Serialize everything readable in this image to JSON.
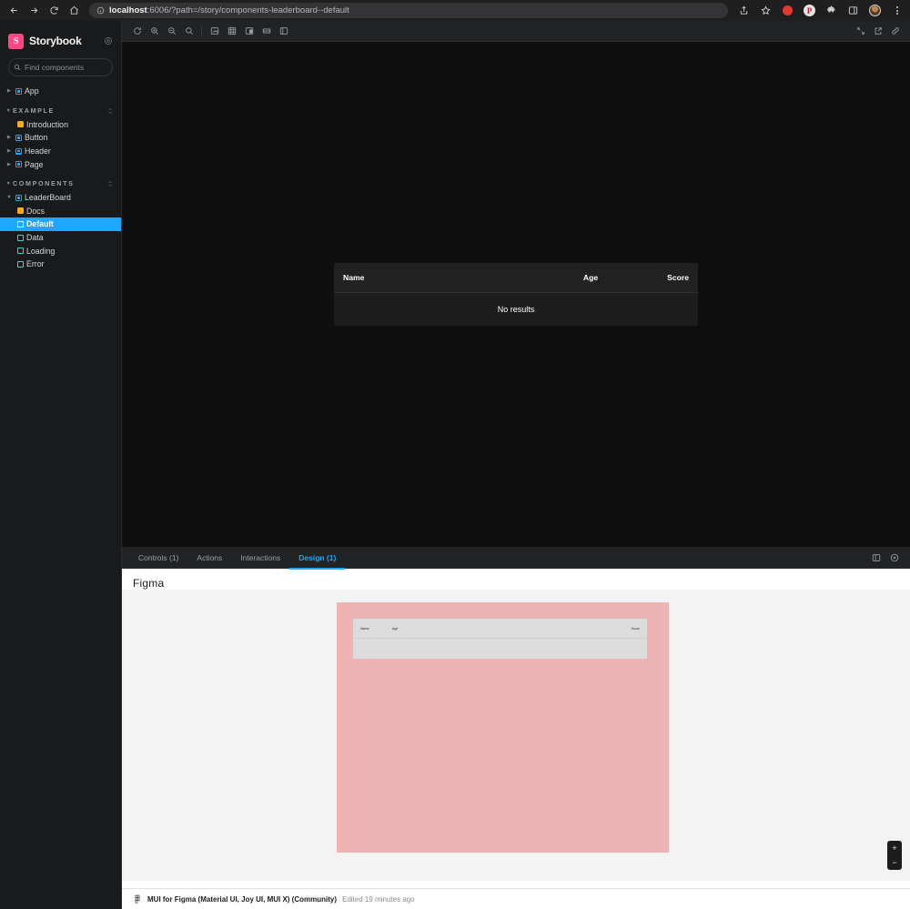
{
  "browser": {
    "back_icon": "arrow-left-icon",
    "forward_icon": "arrow-right-icon",
    "reload_icon": "reload-icon",
    "home_icon": "home-icon",
    "url_host": "localhost",
    "url_rest": ":6006/?path=/story/components-leaderboard--default",
    "info_icon": "info-circle-icon",
    "share_icon": "share-icon",
    "bookmark_icon": "star-icon",
    "record_icon": "record-dot-icon",
    "pinterest_label": "P",
    "extensions_icon": "puzzle-icon",
    "sidepanel_icon": "side-panel-icon",
    "avatar_icon": "user-avatar",
    "menu_icon": "kebab-menu-icon"
  },
  "sidebar": {
    "brand": "Storybook",
    "settings_icon": "gear-icon",
    "search": {
      "placeholder": "Find components",
      "value": "",
      "shortcut": "/",
      "icon": "search-icon"
    },
    "top_items": [
      {
        "label": "App",
        "icon": "component-icon",
        "expandable": true
      }
    ],
    "groups": [
      {
        "label": "EXAMPLE",
        "collapse_icon": "collapse-all-icon",
        "items": [
          {
            "label": "Introduction",
            "icon": "docs-icon",
            "type": "docs",
            "indent": 2
          },
          {
            "label": "Button",
            "icon": "component-icon",
            "type": "component",
            "indent": 1
          },
          {
            "label": "Header",
            "icon": "component-icon",
            "type": "component",
            "indent": 1
          },
          {
            "label": "Page",
            "icon": "component-icon",
            "type": "component",
            "indent": 1
          }
        ]
      },
      {
        "label": "COMPONENTS",
        "collapse_icon": "collapse-all-icon",
        "items": [
          {
            "label": "LeaderBoard",
            "icon": "component-icon",
            "type": "component",
            "indent": 1,
            "expanded": true
          },
          {
            "label": "Docs",
            "icon": "docs-icon",
            "type": "docs",
            "indent": 2
          },
          {
            "label": "Default",
            "icon": "story-icon",
            "type": "story",
            "indent": 2,
            "selected": true
          },
          {
            "label": "Data",
            "icon": "story-icon",
            "type": "story",
            "indent": 2
          },
          {
            "label": "Loading",
            "icon": "story-icon",
            "type": "story",
            "indent": 2
          },
          {
            "label": "Error",
            "icon": "story-icon",
            "type": "story",
            "indent": 2
          }
        ]
      }
    ]
  },
  "canvas_toolbar": {
    "left_buttons": [
      {
        "name": "remount-button",
        "icon": "reload-icon"
      },
      {
        "name": "zoom-in-button",
        "icon": "zoom-in-icon"
      },
      {
        "name": "zoom-out-button",
        "icon": "zoom-out-icon"
      },
      {
        "name": "zoom-reset-button",
        "icon": "zoom-reset-icon"
      },
      {
        "name": "backgrounds-button",
        "icon": "photo-icon"
      },
      {
        "name": "grid-button",
        "icon": "grid-icon"
      },
      {
        "name": "viewport-button",
        "icon": "viewport-icon"
      },
      {
        "name": "measure-button",
        "icon": "measure-icon"
      },
      {
        "name": "outline-button",
        "icon": "outline-icon"
      }
    ],
    "right_buttons": [
      {
        "name": "fullscreen-button",
        "icon": "expand-icon"
      },
      {
        "name": "open-new-tab-button",
        "icon": "external-link-icon"
      },
      {
        "name": "copy-link-button",
        "icon": "link-icon"
      }
    ]
  },
  "preview": {
    "table": {
      "columns": [
        "Name",
        "Age",
        "Score"
      ],
      "empty_message": "No results",
      "rows": []
    }
  },
  "addon_panel": {
    "tabs": [
      {
        "label": "Controls (1)",
        "active": false
      },
      {
        "label": "Actions",
        "active": false
      },
      {
        "label": "Interactions",
        "active": false
      },
      {
        "label": "Design (1)",
        "active": true
      }
    ],
    "layout_icon": "panel-position-icon",
    "close_icon": "close-circle-icon",
    "design": {
      "title": "Figma",
      "mock_columns": [
        "Name",
        "Age",
        "Score"
      ],
      "zoom_in": "+",
      "zoom_out": "−",
      "footer": {
        "icon": "figma-icon",
        "file_name": "MUI for Figma (Material UI, Joy UI, MUI X) (Community)",
        "edited": "Edited 19 minutes ago"
      }
    }
  },
  "colors": {
    "accent": "#1ea7fd",
    "brand": "#ff4785",
    "docs_icon": "#ffae00",
    "story_icon": "#37d5d3",
    "figma_frame": "#eeb3b3"
  }
}
